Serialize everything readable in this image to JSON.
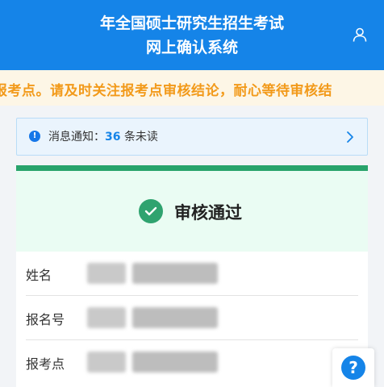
{
  "header": {
    "title_line1": "年全国硕士研究生招生考试",
    "title_line2": "网上确认系统",
    "user_icon": "user-icon"
  },
  "marquee": {
    "text": "报考点。请及时关注报考点审核结论，耐心等待审核结"
  },
  "notice": {
    "label": "消息通知：",
    "count": "36",
    "suffix": "条未读",
    "icon": "info-icon",
    "arrow_icon": "chevron-right-icon"
  },
  "review": {
    "status": "审核通过",
    "status_icon": "check-circle-icon",
    "accent": "#28a36b",
    "fields": [
      {
        "label": "姓名"
      },
      {
        "label": "报名号"
      },
      {
        "label": "报考点"
      }
    ]
  },
  "help": {
    "icon_text": "?",
    "icon": "help-icon"
  },
  "colors": {
    "header": "#1584e8",
    "marquee_text": "#f29a1a",
    "notice_count": "#1584e8"
  }
}
